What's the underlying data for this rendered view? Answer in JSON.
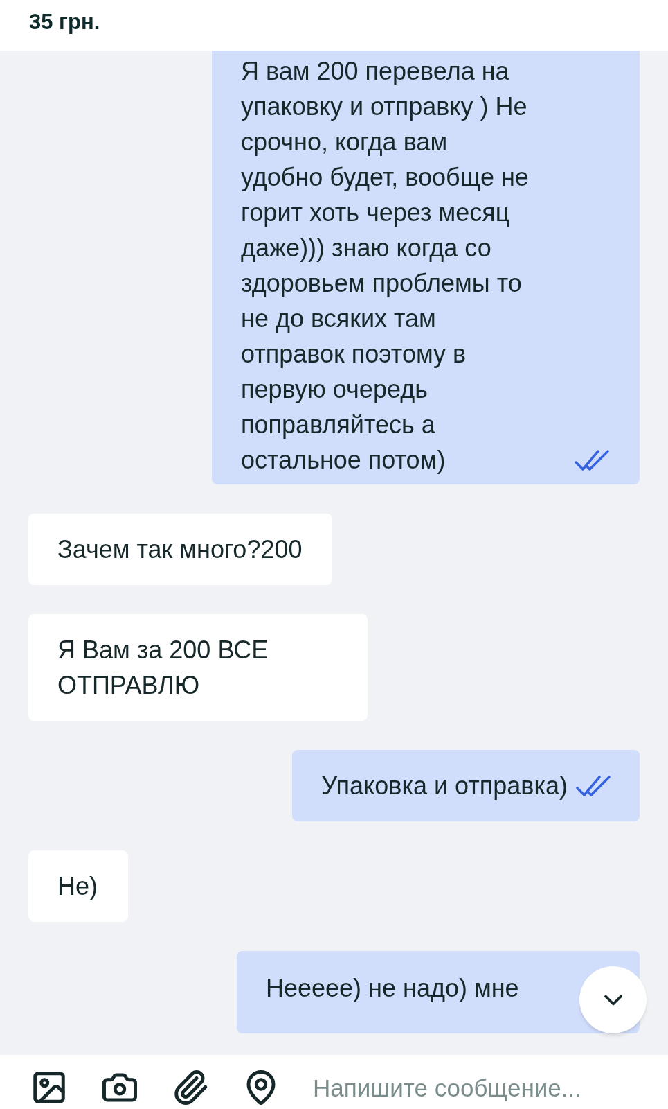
{
  "header": {
    "price": "35 грн."
  },
  "messages": [
    {
      "kind": "out",
      "text": "Я вам 200 перевела на упаковку и отправку ) Не срочно, когда вам удобно будет, вообще не горит хоть через месяц даже))) знаю когда со здоровьем проблемы то не до всяких там отправок поэтому в первую очередь поправляйтесь а остальное потом)",
      "read": true
    },
    {
      "kind": "in",
      "text": "Зачем так много?200"
    },
    {
      "kind": "in",
      "text": "Я Вам за 200 ВСЕ ОТПРАВЛЮ"
    },
    {
      "kind": "out",
      "text": "Упаковка и отправка)",
      "read": true
    },
    {
      "kind": "in",
      "text": "Не)"
    },
    {
      "kind": "out",
      "text": "Неееее) не надо) мне",
      "read": false
    }
  ],
  "composer": {
    "placeholder": "Напишите сообщение..."
  }
}
